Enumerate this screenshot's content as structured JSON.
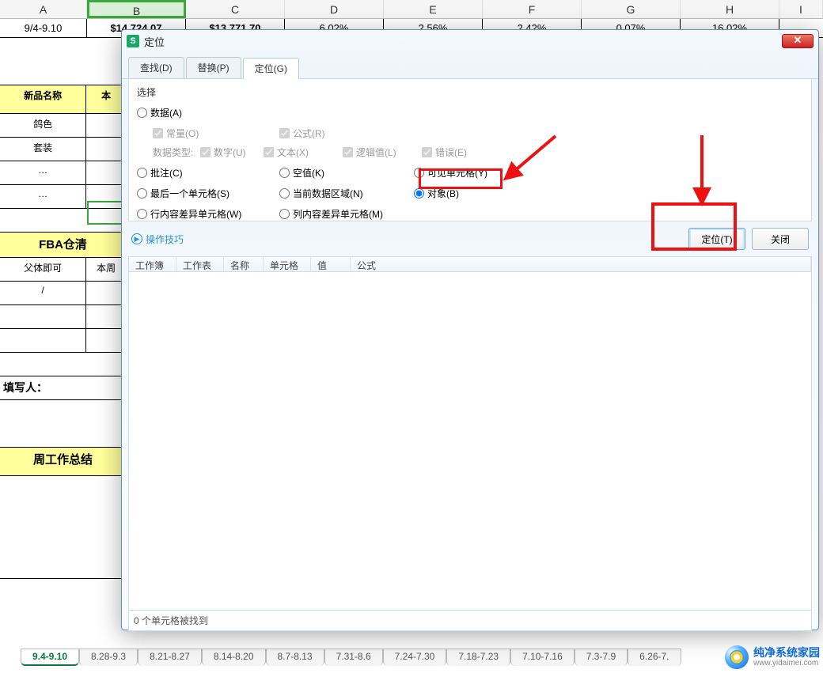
{
  "sheet": {
    "col_headers": [
      "A",
      "B",
      "C",
      "D",
      "E",
      "F",
      "G",
      "H",
      "I"
    ],
    "row1": {
      "A": "9/4-9.10",
      "B": "$14,724.07",
      "C": "$13,771.70",
      "D": "6.02%",
      "E": "2.56%",
      "F": "2.42%",
      "G": "0.07%",
      "H": "16.02%"
    },
    "left": {
      "title1": "新品名称",
      "title1b": "本",
      "p1": "鸽色",
      "p2": "套装",
      "dots": "…",
      "fba": "FBA仓清",
      "parent": "父体即可",
      "parent_b": "本周",
      "slash": "/",
      "writer": "填写人：",
      "summary": "周工作总结"
    },
    "tabs": [
      "9.4-9.10",
      "8.28-9.3",
      "8.21-8.27",
      "8.14-8.20",
      "8.7-8.13",
      "7.31-8.6",
      "7.24-7.30",
      "7.18-7.23",
      "7.10-7.16",
      "7.3-7.9",
      "6.26-7."
    ],
    "active_tab": 0
  },
  "dialog": {
    "title": "定位",
    "tabs": {
      "find": "查找(D)",
      "replace": "替换(P)",
      "goto": "定位(G)"
    },
    "group_title": "选择",
    "radios": {
      "data": "数据(A)",
      "sub_const": "常量(O)",
      "sub_formula": "公式(R)",
      "types_label": "数据类型:",
      "t_num": "数字(U)",
      "t_text": "文本(X)",
      "t_logic": "逻辑值(L)",
      "t_err": "错误(E)",
      "comment": "批注(C)",
      "blank": "空值(K)",
      "visible": "可见单元格(Y)",
      "lastcell": "最后一个单元格(S)",
      "curreg": "当前数据区域(N)",
      "object": "对象(B)",
      "rowdiff": "行内容差异单元格(W)",
      "coldiff": "列内容差异单元格(M)"
    },
    "tips": "操作技巧",
    "btn_go": "定位(T)",
    "btn_close": "关闭",
    "list_headers": {
      "wb": "工作簿",
      "ws": "工作表",
      "name": "名称",
      "cell": "单元格",
      "value": "值",
      "formula": "公式"
    },
    "status": "0 个单元格被找到"
  },
  "watermark": {
    "line1": "纯净系统家园",
    "line2": "www.yidaimei.com"
  }
}
